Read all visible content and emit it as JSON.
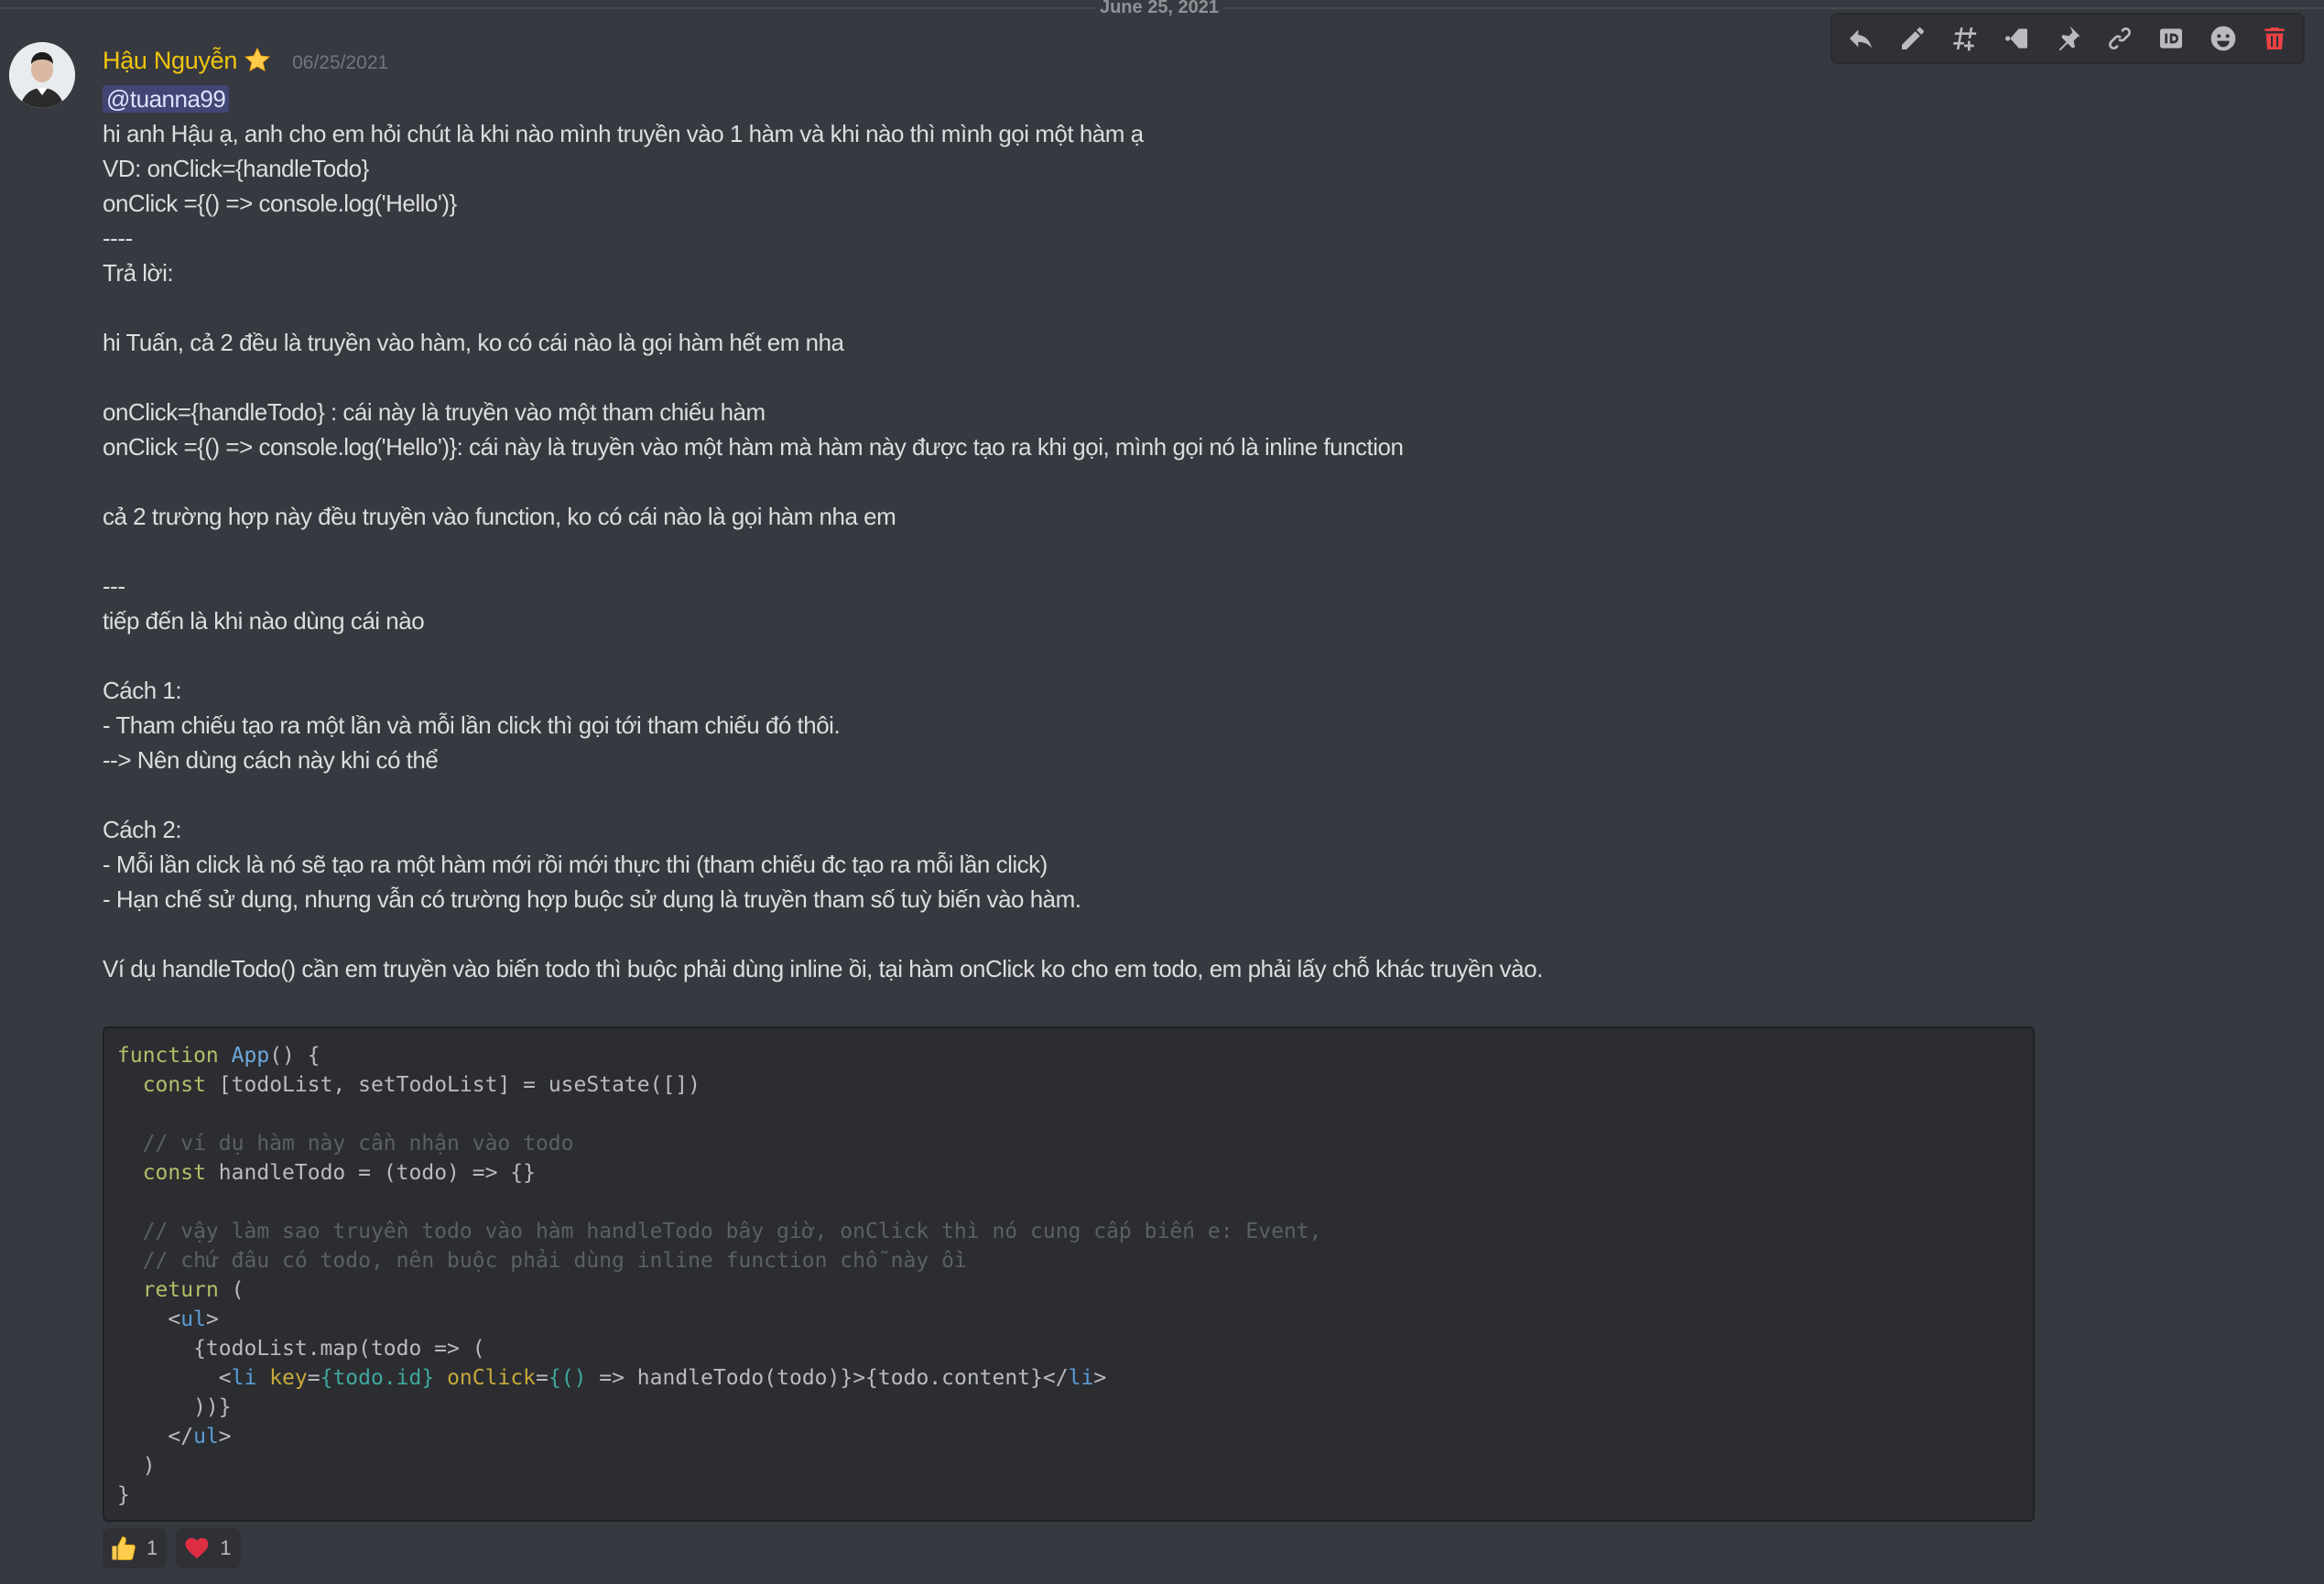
{
  "divider": {
    "date": "June 25, 2021"
  },
  "toolbar": {
    "buttons": [
      {
        "icon": "reply-icon"
      },
      {
        "icon": "edit-icon"
      },
      {
        "icon": "thread-icon"
      },
      {
        "icon": "mark-unread-icon"
      },
      {
        "icon": "pin-icon"
      },
      {
        "icon": "copy-link-icon"
      },
      {
        "icon": "copy-id-icon"
      },
      {
        "icon": "add-reaction-icon"
      },
      {
        "icon": "delete-icon"
      }
    ],
    "delete_color": "#ed4245",
    "icon_color": "#b9bbbe"
  },
  "message": {
    "author": "Hậu Nguyễn",
    "author_color": "#f1c40f",
    "badge_icon": "star-icon",
    "timestamp": "06/25/2021",
    "mention": "@tuanna99",
    "lines": [
      "hi anh Hậu ạ, anh cho em hỏi chút là khi nào mình truyền vào 1 hàm và khi nào thì mình gọi một hàm ạ",
      "VD: onClick={handleTodo}",
      "onClick ={() => console.log('Hello')}",
      "----",
      "Trả lời:",
      "",
      "hi Tuấn, cả 2 đều là truyền vào hàm, ko có cái nào là gọi hàm hết em nha",
      "",
      "onClick={handleTodo} : cái này là truyền vào một tham chiếu hàm",
      "onClick ={() => console.log('Hello')}: cái này là truyền vào một hàm mà hàm này được tạo ra khi gọi, mình gọi nó là inline function",
      "",
      "cả 2 trường hợp này đều truyền vào function, ko có cái nào là gọi hàm nha em",
      "",
      "---",
      "tiếp đến là khi nào dùng cái nào",
      "",
      "Cách 1:",
      "- Tham chiếu tạo ra một lần và mỗi lần click thì gọi tới tham chiếu đó thôi.",
      "--> Nên dùng cách này khi có thể",
      "",
      "Cách 2:",
      "- Mỗi lần click là nó sẽ tạo ra một hàm mới rồi mới thực thi (tham chiếu đc tạo ra mỗi lần click)",
      "- Hạn chế sử dụng, nhưng vẫn có trường hợp buộc sử dụng là truyền tham số tuỳ biến vào hàm.",
      "",
      "Ví dụ handleTodo() cần em truyền vào biến todo thì buộc phải dùng inline ồi, tại hàm onClick ko cho em todo, em phải lấy chỗ khác truyền vào."
    ],
    "code": [
      [
        [
          "kw",
          "function"
        ],
        [
          "pu",
          " "
        ],
        [
          "fn",
          "App"
        ],
        [
          "pu",
          "() {"
        ]
      ],
      [
        [
          "pu",
          "  "
        ],
        [
          "kw",
          "const"
        ],
        [
          "pu",
          " [todoList, setTodoList] = useState([])"
        ]
      ],
      [
        [
          "pu",
          ""
        ]
      ],
      [
        [
          "cm",
          "  // ví dụ hàm này cần nhận vào todo"
        ]
      ],
      [
        [
          "pu",
          "  "
        ],
        [
          "kw",
          "const"
        ],
        [
          "pu",
          " handleTodo = (todo) => {}"
        ]
      ],
      [
        [
          "pu",
          ""
        ]
      ],
      [
        [
          "cm",
          "  // vậy làm sao truyền todo vào hàm handleTodo bây giờ, onClick thì nó cung cấp biến e: Event,"
        ]
      ],
      [
        [
          "cm",
          "  // chứ đâu có todo, nên buộc phải dùng inline function chỗ này ồi"
        ]
      ],
      [
        [
          "pu",
          "  "
        ],
        [
          "kw",
          "return"
        ],
        [
          "pu",
          " ("
        ]
      ],
      [
        [
          "pu",
          "    <"
        ],
        [
          "tag",
          "ul"
        ],
        [
          "pu",
          ">"
        ]
      ],
      [
        [
          "pu",
          "      {todoList.map(todo => ("
        ]
      ],
      [
        [
          "pu",
          "        <"
        ],
        [
          "tag",
          "li"
        ],
        [
          "pu",
          " "
        ],
        [
          "at",
          "key"
        ],
        [
          "pu",
          "="
        ],
        [
          "av",
          "{todo.id}"
        ],
        [
          "pu",
          " "
        ],
        [
          "at",
          "onClick"
        ],
        [
          "pu",
          "="
        ],
        [
          "av",
          "{()"
        ],
        [
          "pu",
          " => handleTodo(todo)}>{todo.content}</"
        ],
        [
          "tag",
          "li"
        ],
        [
          "pu",
          ">"
        ]
      ],
      [
        [
          "pu",
          "      ))}"
        ]
      ],
      [
        [
          "pu",
          "    </"
        ],
        [
          "tag",
          "ul"
        ],
        [
          "pu",
          ">"
        ]
      ],
      [
        [
          "pu",
          "  )"
        ]
      ],
      [
        [
          "pu",
          "}"
        ]
      ]
    ],
    "reactions": [
      {
        "icon": "thumbs-up-icon",
        "count": "1"
      },
      {
        "icon": "heart-icon",
        "count": "1"
      }
    ]
  }
}
